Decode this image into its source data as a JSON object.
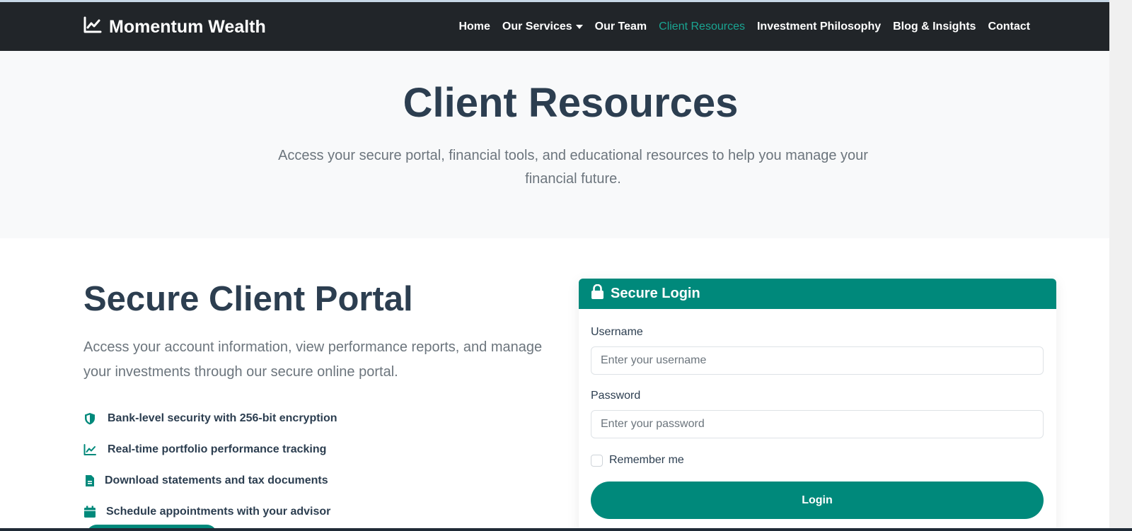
{
  "nav": {
    "brand": "Momentum Wealth",
    "links": [
      {
        "label": "Home"
      },
      {
        "label": "Our Services"
      },
      {
        "label": "Our Team"
      },
      {
        "label": "Client Resources"
      },
      {
        "label": "Investment Philosophy"
      },
      {
        "label": "Blog & Insights"
      },
      {
        "label": "Contact"
      }
    ],
    "active": "Client Resources"
  },
  "hero": {
    "title": "Client Resources",
    "subtitle": "Access your secure portal, financial tools, and educational resources to help you manage your financial future."
  },
  "portal": {
    "title": "Secure Client Portal",
    "description": "Access your account information, view performance reports, and manage your investments through our secure online portal.",
    "features": [
      {
        "icon": "shield-icon",
        "text": "Bank-level security with 256-bit encryption"
      },
      {
        "icon": "chart-line-icon",
        "text": "Real-time portfolio performance tracking"
      },
      {
        "icon": "file-icon",
        "text": "Download statements and tax documents"
      },
      {
        "icon": "calendar-icon",
        "text": "Schedule appointments with your advisor"
      }
    ]
  },
  "login": {
    "header": "Secure Login",
    "username_label": "Username",
    "username_placeholder": "Enter your username",
    "password_label": "Password",
    "password_placeholder": "Enter your password",
    "remember_label": "Remember me",
    "button": "Login"
  },
  "colors": {
    "accent": "#00897b",
    "nav_bg": "#212529",
    "heading": "#2c3e50"
  }
}
